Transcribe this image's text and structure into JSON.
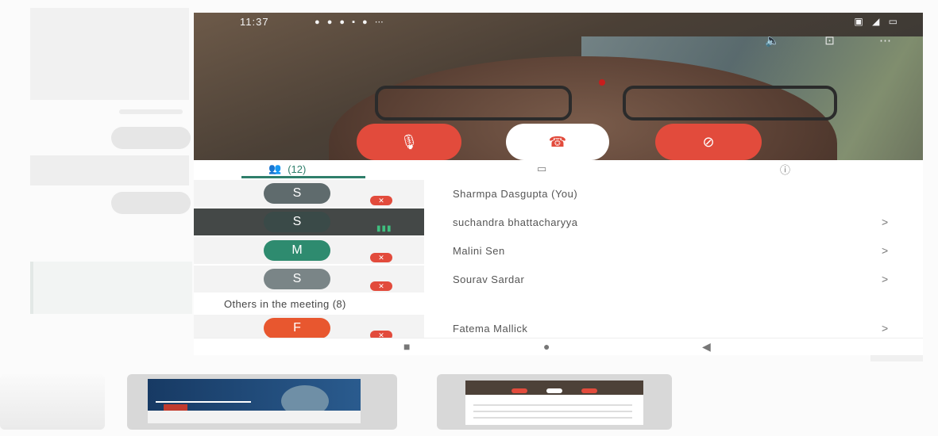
{
  "status_bar": {
    "time": "11:37",
    "dots": "● ● ● ▪ ● ⋯",
    "right_icons": "▣ ◢ ▭"
  },
  "call": {
    "top_icons": [
      {
        "name": "speaker-icon",
        "glyph": "🔈"
      },
      {
        "name": "switch-camera-icon",
        "glyph": "⊡"
      },
      {
        "name": "more-icon",
        "glyph": "⋯"
      }
    ],
    "mic_glyph": "🎙",
    "end_glyph": "☎",
    "camera_glyph": "⊘"
  },
  "tabs": {
    "people_glyph": "👥",
    "people_count": "(12)",
    "chat_glyph": "▭",
    "info_glyph": "ⓘ"
  },
  "participants": [
    {
      "initial": "S",
      "name": "Sharmpa Dasgupta (You)",
      "color": "#5f6b6d",
      "status": "muted",
      "chevron": ""
    },
    {
      "initial": "S",
      "name": "suchandra bhattacharyya",
      "color": "#3a4a48",
      "status": "speaking",
      "chevron": ">"
    },
    {
      "initial": "M",
      "name": "Malini Sen",
      "color": "#2e8b6f",
      "status": "muted",
      "chevron": ">"
    },
    {
      "initial": "S",
      "name": "Sourav Sardar",
      "color": "#7a8587",
      "status": "muted",
      "chevron": ">"
    }
  ],
  "others_label": "Others in the meeting (8)",
  "others": [
    {
      "initial": "F",
      "name": "Fatema Mallick",
      "color": "#e8572f",
      "status": "muted",
      "chevron": ">"
    }
  ],
  "badges": {
    "muted_glyph": "✕",
    "speaking_glyph": "▮▮▮"
  },
  "navbar": {
    "recents": "■",
    "home": "●",
    "back": "◀"
  }
}
